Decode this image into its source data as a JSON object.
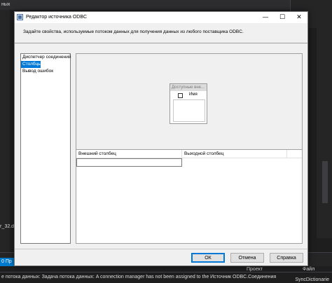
{
  "ide": {
    "top_text": "ных",
    "left_label_1": "г_32.d",
    "left_label_2": "",
    "status_text": "0 Пр",
    "right_labels": [
      "Проект",
      "Файл"
    ],
    "error_text": "е потока данных: Задача потока данных: A connection manager has not been assigned to the Источник ODBC.Соединения",
    "error_right": "SyncDictionarie"
  },
  "dialog": {
    "title": "Редактор источника ODBC",
    "controls": {
      "minimize": "—",
      "maximize": "☐",
      "close": "✕"
    },
    "description": "Задайте свойства, используемые потоком данных для получения данных из любого поставщика ODBC.",
    "nav_items": [
      {
        "label": "Диспетчер соединений",
        "selected": false
      },
      {
        "label": "Столбцы",
        "selected": true
      },
      {
        "label": "Вывод ошибок",
        "selected": false
      }
    ],
    "available_columns": {
      "title": "Доступные вне...",
      "column_header": "Имя"
    },
    "mapping_grid": {
      "headers": [
        "Внешний столбец",
        "Выходной столбец"
      ]
    },
    "buttons": {
      "ok": "ОК",
      "cancel": "Отмена",
      "help": "Справка"
    }
  }
}
